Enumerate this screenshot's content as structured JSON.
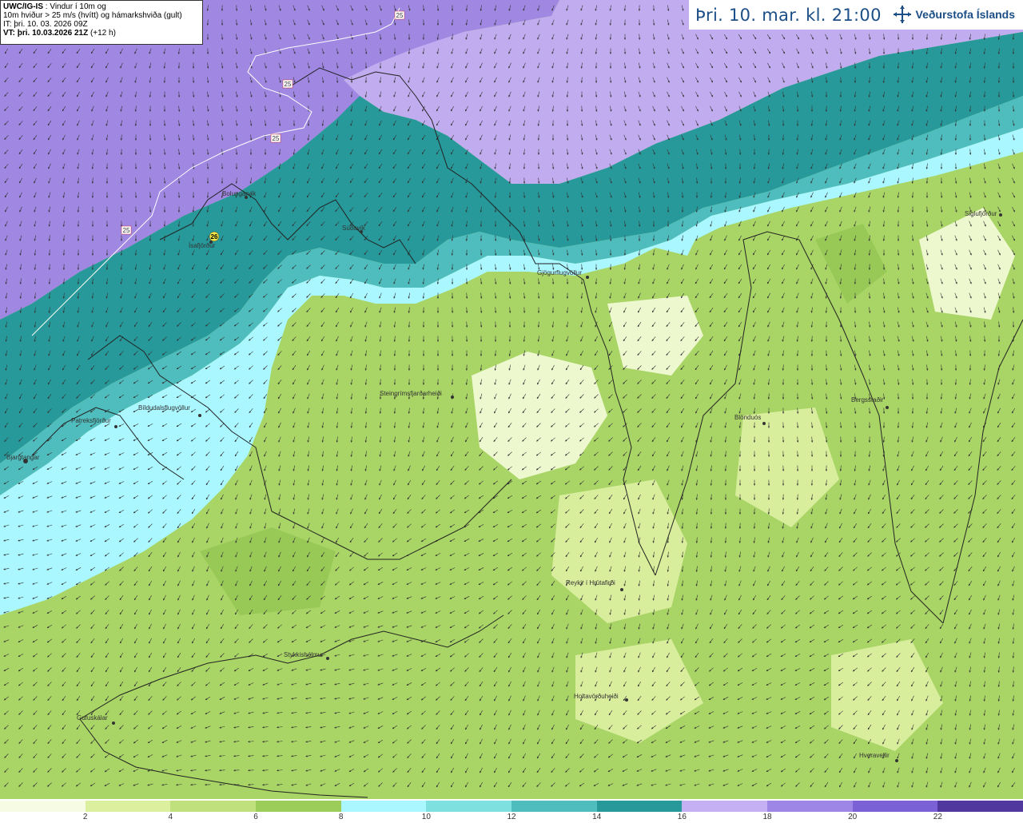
{
  "info": {
    "line1_bold": "UWC/IG-IS",
    "line1_rest": " : Vindur í 10m og",
    "line2": "10m hviður > 25 m/s (hvítt) og hámarkshviða (gult)",
    "line3": "IT: þri. 10. 03. 2026 09Z",
    "line4_bold": "VT: þri. 10.03.2026 21Z",
    "line4_rest": " (+12 h)"
  },
  "time_label": "Þri. 10. mar. kl. 21:00",
  "logo": {
    "text": "Veðurstofa Íslands",
    "icon": "vedurstofa-snowflake-icon",
    "color": "#1c4e87"
  },
  "legend": {
    "ticks": [
      "2",
      "4",
      "6",
      "8",
      "10",
      "12",
      "14",
      "16",
      "18",
      "20",
      "22"
    ],
    "colors": [
      "#f6fbe4",
      "#dcef9f",
      "#bfe07c",
      "#9ccd5a",
      "#aaf7ff",
      "#7fe0e0",
      "#4fbdbd",
      "#27999a",
      "#c4b0f2",
      "#9d86e6",
      "#7a62d6",
      "#51389e"
    ]
  },
  "places": [
    {
      "name": "Bolungarvík"
    },
    {
      "name": "Ísafjörður"
    },
    {
      "name": "Súðavík"
    },
    {
      "name": "Gjögurflugvöllur"
    },
    {
      "name": "Siglufjörður"
    },
    {
      "name": "Steingrímsfjarðarheiði"
    },
    {
      "name": "Blönduós"
    },
    {
      "name": "Bergsstaðir"
    },
    {
      "name": "Bíldudalsflugvöllur"
    },
    {
      "name": "Patreksfjörður"
    },
    {
      "name": "Bjargtangar"
    },
    {
      "name": "Reykir í Hrútafirði"
    },
    {
      "name": "Stykkishólmur"
    },
    {
      "name": "Holtavörðuheiði"
    },
    {
      "name": "Gufuskálar"
    },
    {
      "name": "Hveravellir"
    }
  ],
  "isotach_labels": [
    "25",
    "25",
    "25",
    "25"
  ],
  "max_gust_marker": "26"
}
